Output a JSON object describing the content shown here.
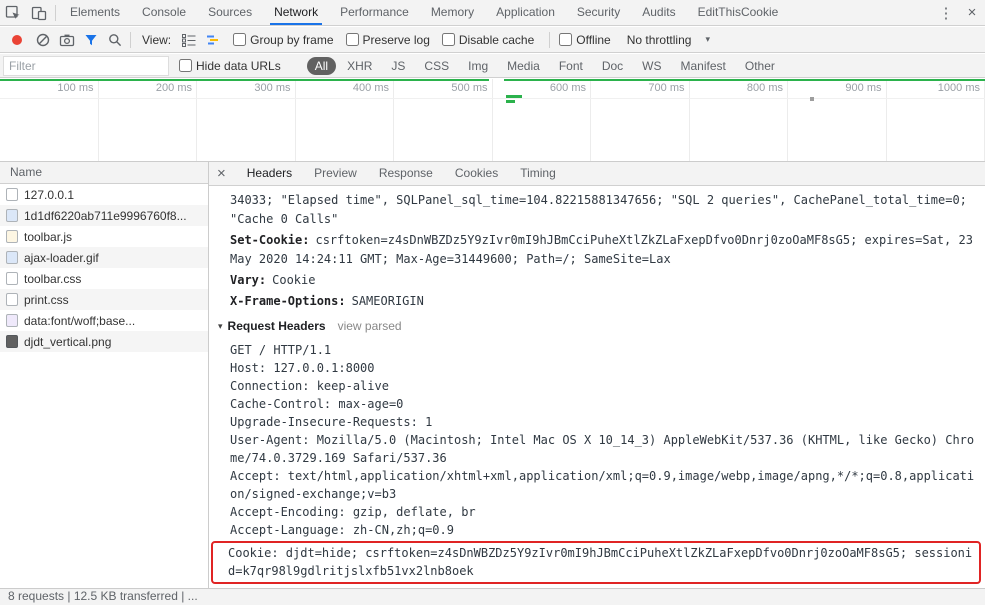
{
  "window": {
    "tabs": [
      {
        "label": "Elements",
        "active": false
      },
      {
        "label": "Console",
        "active": false
      },
      {
        "label": "Sources",
        "active": false
      },
      {
        "label": "Network",
        "active": true
      },
      {
        "label": "Performance",
        "active": false
      },
      {
        "label": "Memory",
        "active": false
      },
      {
        "label": "Application",
        "active": false
      },
      {
        "label": "Security",
        "active": false
      },
      {
        "label": "Audits",
        "active": false
      },
      {
        "label": "EditThisCookie",
        "active": false
      }
    ],
    "menu_icon": "⋮",
    "close_icon": "×"
  },
  "toolbar": {
    "view_label": "View:",
    "group_by_frame": "Group by frame",
    "preserve_log": "Preserve log",
    "disable_cache": "Disable cache",
    "offline": "Offline",
    "throttling": "No throttling",
    "caret": "▾"
  },
  "filter_bar": {
    "placeholder": "Filter",
    "hide_data_urls": "Hide data URLs",
    "pills": [
      {
        "label": "All",
        "active": true
      },
      {
        "label": "XHR",
        "active": false
      },
      {
        "label": "JS",
        "active": false
      },
      {
        "label": "CSS",
        "active": false
      },
      {
        "label": "Img",
        "active": false
      },
      {
        "label": "Media",
        "active": false
      },
      {
        "label": "Font",
        "active": false
      },
      {
        "label": "Doc",
        "active": false
      },
      {
        "label": "WS",
        "active": false
      },
      {
        "label": "Manifest",
        "active": false
      },
      {
        "label": "Other",
        "active": false
      }
    ]
  },
  "timeline": {
    "ticks": [
      "100 ms",
      "200 ms",
      "300 ms",
      "400 ms",
      "500 ms",
      "600 ms",
      "700 ms",
      "800 ms",
      "900 ms",
      "1000 ms"
    ]
  },
  "request_list": {
    "header": "Name",
    "items": [
      {
        "name": "127.0.0.1",
        "icon": "document"
      },
      {
        "name": "1d1df6220ab711e9996760f8...",
        "icon": "image"
      },
      {
        "name": "toolbar.js",
        "icon": "script"
      },
      {
        "name": "ajax-loader.gif",
        "icon": "image"
      },
      {
        "name": "toolbar.css",
        "icon": "stylesheet"
      },
      {
        "name": "print.css",
        "icon": "stylesheet"
      },
      {
        "name": "data:font/woff;base...",
        "icon": "font"
      },
      {
        "name": "djdt_vertical.png",
        "icon": "image-dark"
      }
    ]
  },
  "detail": {
    "close_icon": "×",
    "tabs": [
      {
        "label": "Headers",
        "active": true
      },
      {
        "label": "Preview",
        "active": false
      },
      {
        "label": "Response",
        "active": false
      },
      {
        "label": "Cookies",
        "active": false
      },
      {
        "label": "Timing",
        "active": false
      }
    ],
    "response_headers": [
      {
        "key": "",
        "value": "34033; \"Elapsed time\", SQLPanel_sql_time=104.82215881347656; \"SQL 2 queries\", CachePanel_total_time=0; \"Cache 0 Calls\""
      },
      {
        "key": "Set-Cookie:",
        "value": "csrftoken=z4sDnWBZDz5Y9zIvr0mI9hJBmCciPuheXtlZkZLaFxepDfvo0Dnrj0zoOaMF8sG5; expires=Sat, 23 May 2020 14:24:11 GMT; Max-Age=31449600; Path=/; SameSite=Lax"
      },
      {
        "key": "Vary:",
        "value": "Cookie"
      },
      {
        "key": "X-Frame-Options:",
        "value": "SAMEORIGIN"
      }
    ],
    "request_headers_section": {
      "disclosure": "▾",
      "title": "Request Headers",
      "link": "view parsed"
    },
    "request_lines": [
      "GET / HTTP/1.1",
      "Host: 127.0.0.1:8000",
      "Connection: keep-alive",
      "Cache-Control: max-age=0",
      "Upgrade-Insecure-Requests: 1",
      "User-Agent: Mozilla/5.0 (Macintosh; Intel Mac OS X 10_14_3) AppleWebKit/537.36 (KHTML, like Gecko) Chrome/74.0.3729.169 Safari/537.36",
      "Accept: text/html,application/xhtml+xml,application/xml;q=0.9,image/webp,image/apng,*/*;q=0.8,application/signed-exchange;v=b3",
      "Accept-Encoding: gzip, deflate, br",
      "Accept-Language: zh-CN,zh;q=0.9"
    ],
    "cookie_highlight": "Cookie: djdt=hide; csrftoken=z4sDnWBZDz5Y9zIvr0mI9hJBmCciPuheXtlZkZLaFxepDfvo0Dnrj0zoOaMF8sG5; sessionid=k7qr98l9gdlritjslxfb51vx2lnb8oek"
  },
  "status_bar": {
    "text": "8 requests | 12.5 KB transferred | ..."
  },
  "colors": {
    "accent": "#1a73e8",
    "record": "#ea4335",
    "highlight": "#e02424",
    "green": "#2bb24c",
    "pill_active": "#616161"
  }
}
